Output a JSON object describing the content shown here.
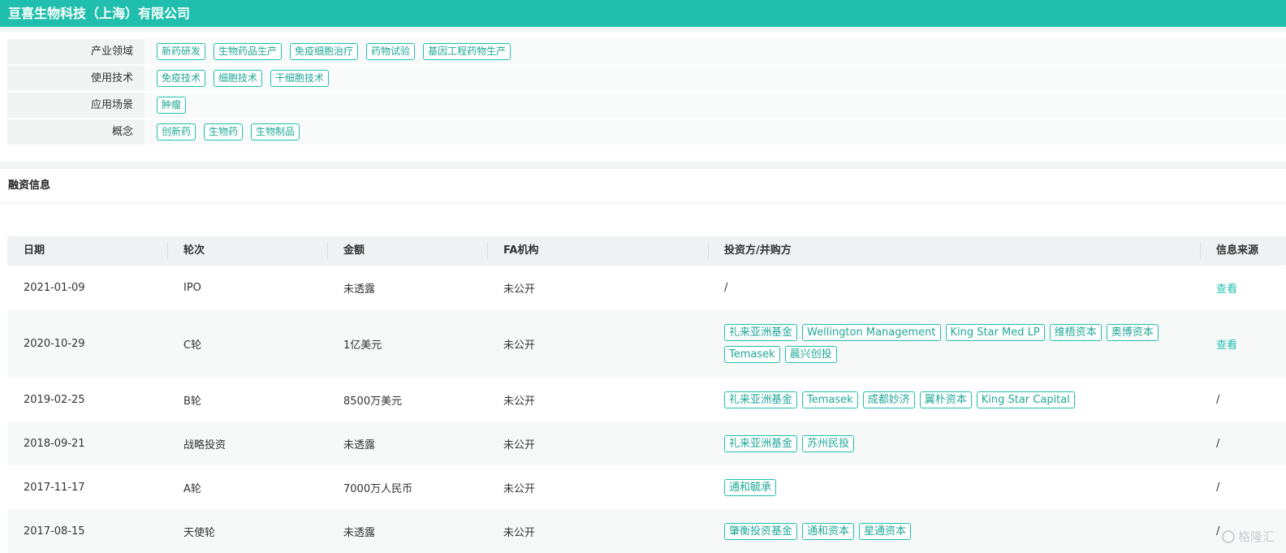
{
  "company_title": "亘喜生物科技（上海）有限公司",
  "tag_rows": [
    {
      "label": "产业领域",
      "tags": [
        "新药研发",
        "生物药品生产",
        "免疫细胞治疗",
        "药物试验",
        "基因工程药物生产"
      ]
    },
    {
      "label": "使用技术",
      "tags": [
        "免疫技术",
        "细胞技术",
        "干细胞技术"
      ]
    },
    {
      "label": "应用场景",
      "tags": [
        "肿瘤"
      ]
    },
    {
      "label": "概念",
      "tags": [
        "创新药",
        "生物药",
        "生物制品"
      ]
    }
  ],
  "financing": {
    "section_title": "融资信息",
    "columns": [
      "日期",
      "轮次",
      "金额",
      "FA机构",
      "投资方/并购方",
      "信息来源"
    ],
    "rows": [
      {
        "date": "2021-01-09",
        "round": "IPO",
        "amount": "未透露",
        "fa": "未公开",
        "investors_text": "/",
        "investors": [],
        "source": "查看",
        "source_link": true
      },
      {
        "date": "2020-10-29",
        "round": "C轮",
        "amount": "1亿美元",
        "fa": "未公开",
        "investors_text": "",
        "investors": [
          "礼来亚洲基金",
          "Wellington Management",
          "King Star Med LP",
          "维梧资本",
          "奥博资本",
          "Temasek",
          "晨兴创投"
        ],
        "source": "查看",
        "source_link": true
      },
      {
        "date": "2019-02-25",
        "round": "B轮",
        "amount": "8500万美元",
        "fa": "未公开",
        "investors_text": "",
        "investors": [
          "礼来亚洲基金",
          "Temasek",
          "成都妙济",
          "翼朴资本",
          "King Star Capital"
        ],
        "source": "/",
        "source_link": false
      },
      {
        "date": "2018-09-21",
        "round": "战略投资",
        "amount": "未透露",
        "fa": "未公开",
        "investors_text": "",
        "investors": [
          "礼来亚洲基金",
          "苏州民投"
        ],
        "source": "/",
        "source_link": false
      },
      {
        "date": "2017-11-17",
        "round": "A轮",
        "amount": "7000万人民币",
        "fa": "未公开",
        "investors_text": "",
        "investors": [
          "通和毓承"
        ],
        "source": "/",
        "source_link": false
      },
      {
        "date": "2017-08-15",
        "round": "天使轮",
        "amount": "未透露",
        "fa": "未公开",
        "investors_text": "",
        "investors": [
          "肇衡投资基金",
          "通和资本",
          "星通资本"
        ],
        "source": "/",
        "source_link": false
      }
    ]
  },
  "watermark": "格隆汇",
  "colors": {
    "accent": "#20bfad"
  }
}
